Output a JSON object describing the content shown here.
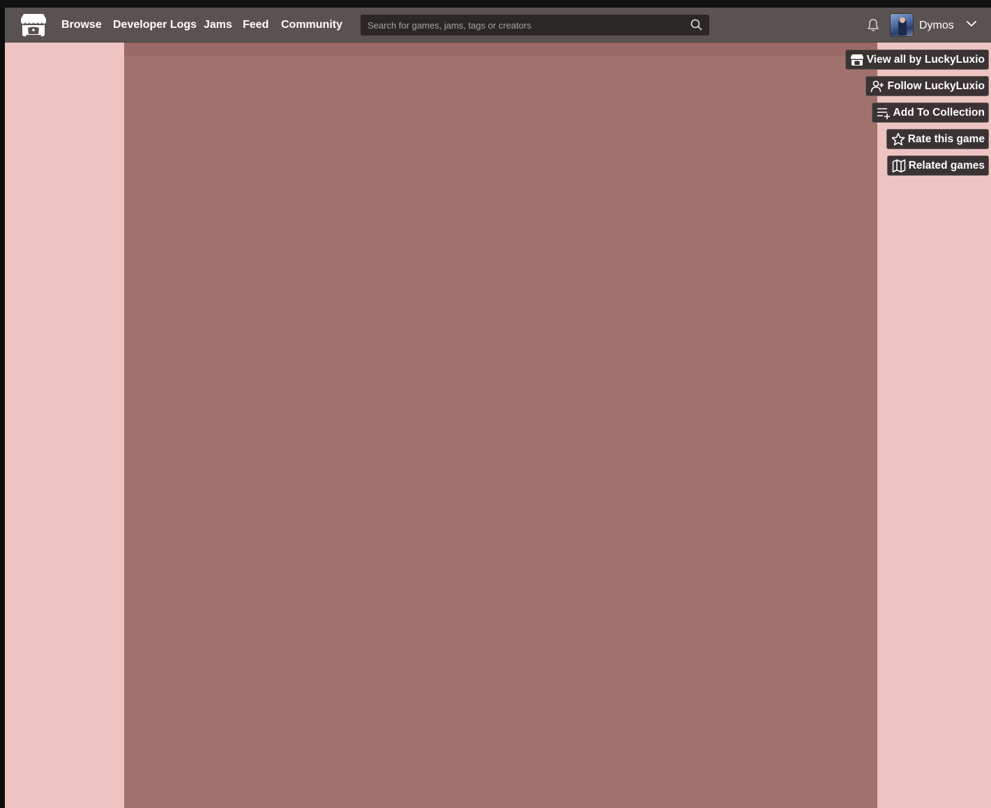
{
  "nav": {
    "links": [
      "Browse",
      "Developer Logs",
      "Jams",
      "Feed",
      "Community"
    ],
    "search_placeholder": "Search for games, jams, tags or creators"
  },
  "user": {
    "name": "Dymos"
  },
  "sidebar": {
    "buttons": [
      {
        "label": "View all by LuckyLuxio",
        "icon": "itchio-logo-icon"
      },
      {
        "label": "Follow LuckyLuxio",
        "icon": "user-plus-icon"
      },
      {
        "label": "Add To Collection",
        "icon": "list-add-icon"
      },
      {
        "label": "Rate this game",
        "icon": "star-icon"
      },
      {
        "label": "Related games",
        "icon": "map-icon"
      }
    ]
  },
  "colors": {
    "header": "#5a5250",
    "page_background": "#edc4c2",
    "content_column": "#a1726d",
    "button_background": "#3b3333"
  }
}
